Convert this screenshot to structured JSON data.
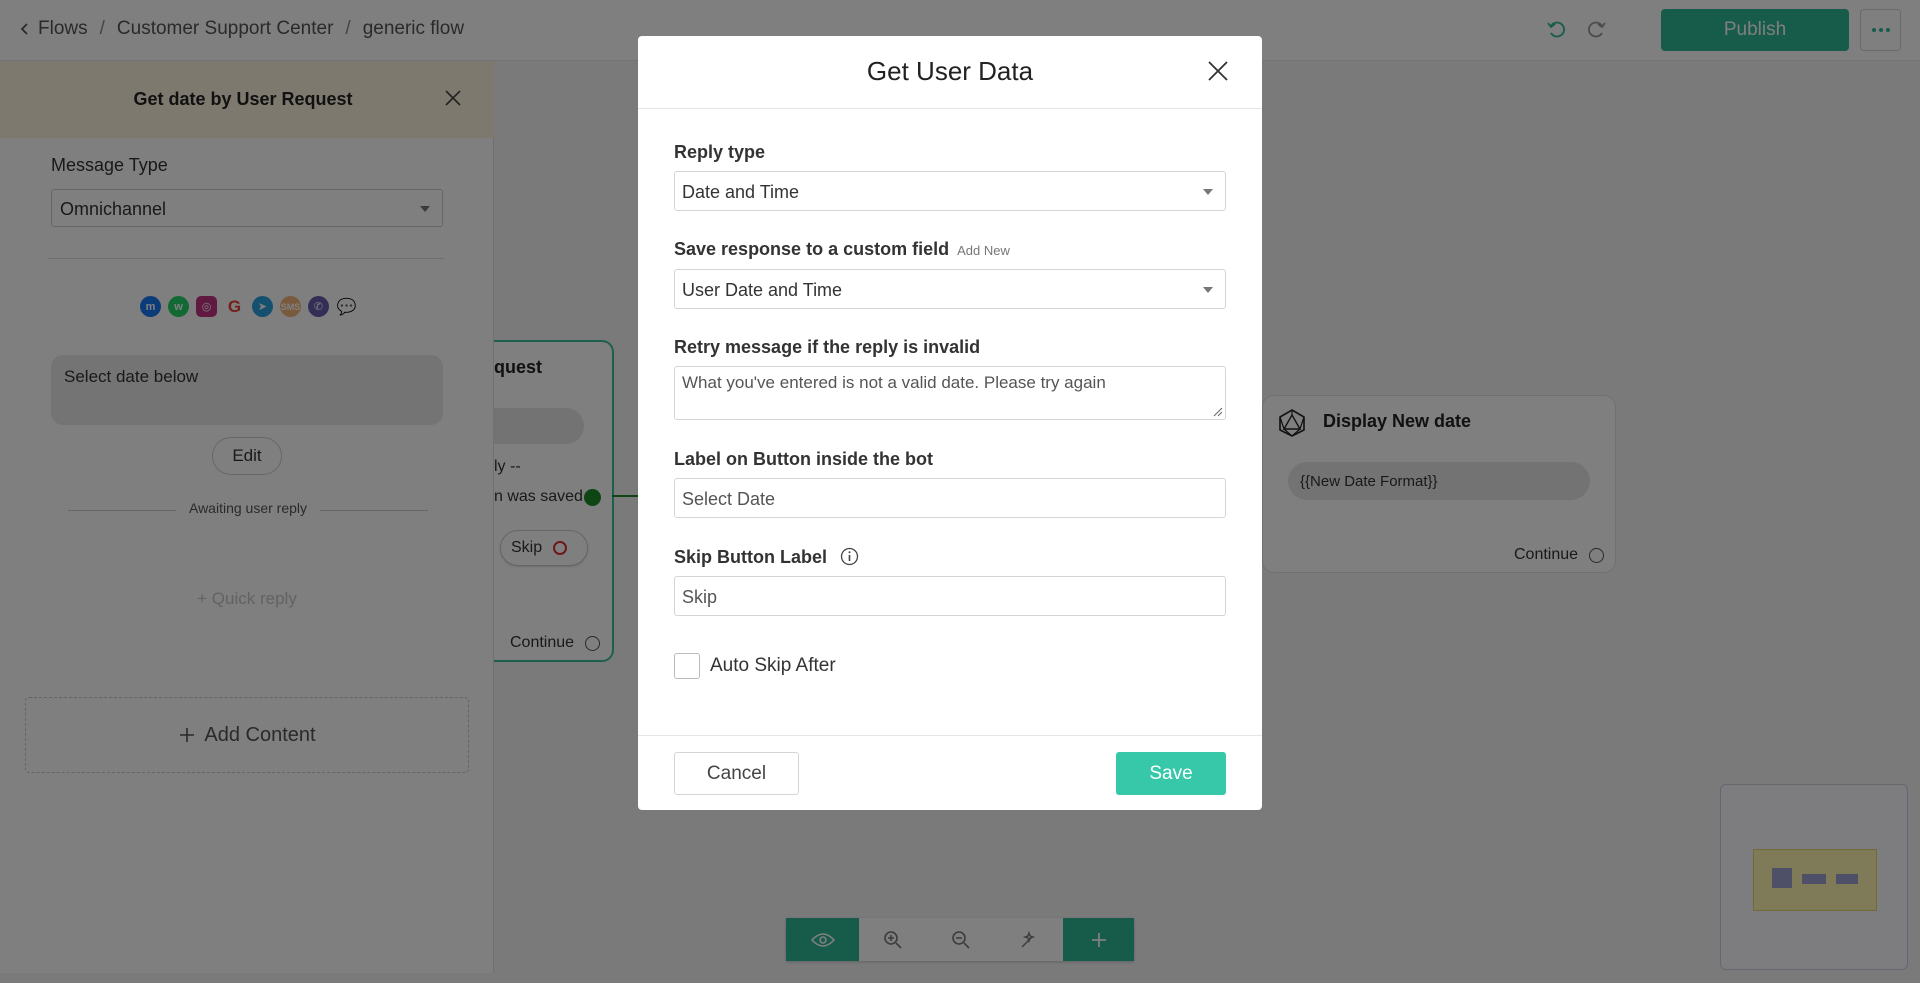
{
  "breadcrumb": {
    "back": "Flows",
    "sep": "/",
    "level1": "Customer Support Center",
    "level2": "generic flow"
  },
  "toolbar": {
    "publish_label": "Publish"
  },
  "left_panel": {
    "title": "Get date by User Request",
    "message_type_label": "Message Type",
    "message_type_value": "Omnichannel",
    "channels": [
      "messenger-icon",
      "whatsapp-icon",
      "instagram-icon",
      "google-icon",
      "telegram-icon",
      "sms-icon",
      "viber-icon",
      "chat-icon"
    ],
    "message_text": "Select date below",
    "edit_label": "Edit",
    "awaiting_label": "Awaiting user reply",
    "quick_reply_label": "+ Quick reply",
    "add_content_label": "Add Content"
  },
  "canvas": {
    "node1": {
      "title_fragment": "quest",
      "row1": "ly --",
      "row2": "n was saved",
      "skip_label": "Skip",
      "continue_label": "Continue"
    },
    "node2": {
      "title": "Display New date",
      "value": "{{New Date Format}}",
      "continue_label": "Continue"
    }
  },
  "modal": {
    "title": "Get User Data",
    "reply_type_label": "Reply type",
    "reply_type_value": "Date and Time",
    "custom_field_label": "Save response to a custom field",
    "add_new_label": "Add New",
    "custom_field_value": "User Date and Time",
    "retry_label": "Retry message if the reply is invalid",
    "retry_value": "What you've entered is not a valid date. Please try again",
    "button_label_label": "Label on Button inside the bot",
    "button_label_value": "Select Date",
    "skip_label_label": "Skip Button Label",
    "skip_label_value": "Skip",
    "auto_skip_label": "Auto Skip After",
    "cancel_label": "Cancel",
    "save_label": "Save"
  },
  "colors": {
    "accent": "#2eb894",
    "save": "#36c8a8",
    "panel_header": "#fbf3dc"
  }
}
